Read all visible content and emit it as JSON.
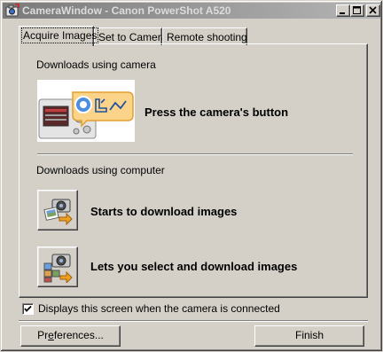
{
  "window": {
    "title": "CameraWindow - Canon PowerShot A520"
  },
  "tabs": [
    {
      "label": "Acquire Images",
      "active": true
    },
    {
      "label": "Set to Camera",
      "active": false
    },
    {
      "label": "Remote shooting",
      "active": false
    }
  ],
  "camera_section": {
    "heading": "Downloads using camera",
    "instruction": "Press the camera's button"
  },
  "computer_section": {
    "heading": "Downloads using computer",
    "actions": [
      {
        "label": "Starts to download images",
        "icon": "camera-download-icon"
      },
      {
        "label": "Lets you select and download images",
        "icon": "camera-select-download-icon"
      }
    ]
  },
  "startup_option": {
    "label": "Displays this screen when the camera is connected",
    "checked": true
  },
  "buttons": {
    "preferences_before": "Pr",
    "preferences_mnemonic": "e",
    "preferences_after": "ferences...",
    "finish": "Finish"
  },
  "colors": {
    "face": "#d4d0c8",
    "titlebar_inactive": "#7a7a7a",
    "accent_blue": "#3a6ec8",
    "accent_orange": "#f0a020"
  }
}
